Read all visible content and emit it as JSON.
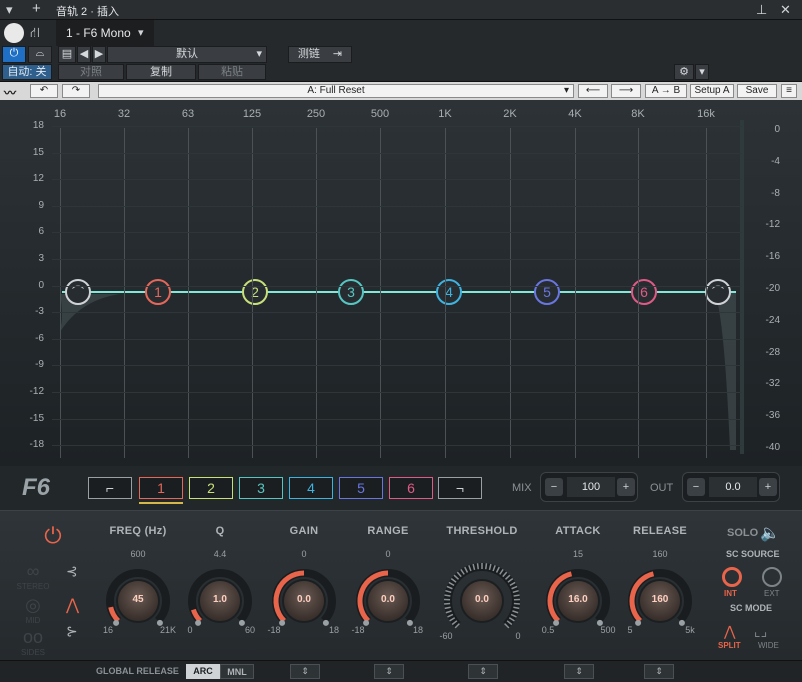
{
  "host": {
    "window_title": "音轨 2 · 插入",
    "plugin_slot": "1 - F6 Mono",
    "preset": "默认",
    "sidechain_label": "测链",
    "auto_label": "自动: 关",
    "compare_label": "对照",
    "copy_label": "复制",
    "paste_label": "粘贴"
  },
  "toolbar": {
    "preset_name": "A: Full Reset",
    "ab_label": "A → B",
    "setup_label": "Setup A",
    "save_label": "Save"
  },
  "graph": {
    "freq_labels": [
      "16",
      "32",
      "63",
      "125",
      "250",
      "500",
      "1K",
      "2K",
      "4K",
      "8K",
      "16k"
    ],
    "db_labels": [
      "18",
      "15",
      "12",
      "9",
      "6",
      "3",
      "0",
      "-3",
      "-6",
      "-9",
      "-12",
      "-15",
      "-18"
    ],
    "out_labels": [
      "0",
      "-4",
      "-8",
      "-12",
      "-16",
      "-20",
      "-24",
      "-28",
      "-32",
      "-36",
      "-40"
    ],
    "bands": [
      {
        "label": "1",
        "color": "#e5675a"
      },
      {
        "label": "2",
        "color": "#c8e07a"
      },
      {
        "label": "3",
        "color": "#57c6c2"
      },
      {
        "label": "4",
        "color": "#3fb3e0"
      },
      {
        "label": "5",
        "color": "#6a76e0"
      },
      {
        "label": "6",
        "color": "#e05a86"
      }
    ]
  },
  "strip": {
    "logo": "F6",
    "band_buttons": [
      "1",
      "2",
      "3",
      "4",
      "5",
      "6"
    ],
    "mix_label": "MIX",
    "mix_value": "100",
    "out_label": "OUT",
    "out_value": "0.0"
  },
  "controls": {
    "freq": {
      "caption": "FREQ (Hz)",
      "top": "600",
      "min": "16",
      "max": "21K",
      "value": "45"
    },
    "q": {
      "caption": "Q",
      "top": "4.4",
      "min": "0",
      "max": "60",
      "value": "1.0"
    },
    "gain": {
      "caption": "GAIN",
      "top": "0",
      "min": "-18",
      "max": "18",
      "value": "0.0"
    },
    "range": {
      "caption": "RANGE",
      "top": "0",
      "min": "-18",
      "max": "18",
      "value": "0.0"
    },
    "threshold": {
      "caption": "THRESHOLD",
      "min": "-60",
      "max": "0",
      "value": "0.0"
    },
    "attack": {
      "caption": "ATTACK",
      "top": "15",
      "min": "0.5",
      "max": "500",
      "value": "16.0"
    },
    "release": {
      "caption": "RELEASE",
      "top": "160",
      "min": "5",
      "max": "5k",
      "value": "160"
    },
    "solo_label": "SOLO",
    "sc_source_label": "SC SOURCE",
    "int_label": "INT",
    "ext_label": "EXT",
    "sc_mode_label": "SC MODE",
    "split_label": "SPLIT",
    "wide_label": "WIDE",
    "stereo_label": "STEREO",
    "mid_label": "MID",
    "sides_label": "SIDES"
  },
  "bottom": {
    "global_release_label": "GLOBAL RELEASE",
    "arc_label": "ARC",
    "mnl_label": "MNL"
  },
  "colors": {
    "accent": "#e8644a",
    "curve": "#7fe8d8"
  }
}
